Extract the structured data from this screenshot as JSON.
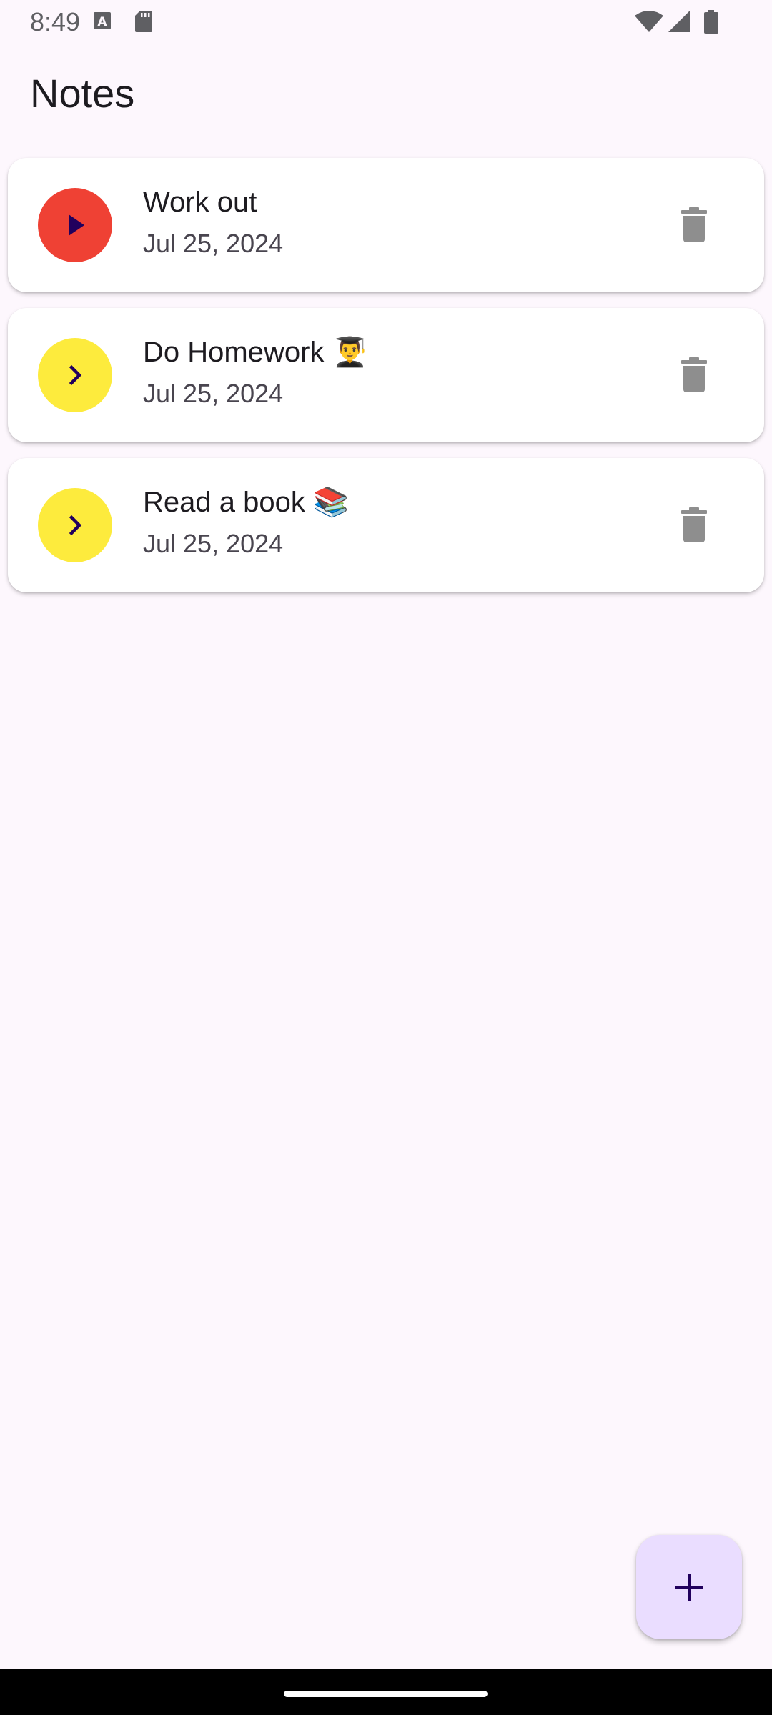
{
  "status_bar": {
    "time": "8:49",
    "icons": [
      "a-notification-icon",
      "sd-card-icon",
      "wifi-icon",
      "signal-icon",
      "battery-icon"
    ]
  },
  "app": {
    "title": "Notes"
  },
  "notes": [
    {
      "title": "Work out",
      "date": "Jul 25, 2024",
      "state": "active",
      "toggle_icon": "play-icon",
      "toggle_color": "#EF4134"
    },
    {
      "title": "Do Homework 👨‍🎓",
      "date": "Jul 25, 2024",
      "state": "pending",
      "toggle_icon": "chevron-right-icon",
      "toggle_color": "#FDEB3D"
    },
    {
      "title": "Read a book 📚",
      "date": "Jul 25, 2024",
      "state": "pending",
      "toggle_icon": "chevron-right-icon",
      "toggle_color": "#FDEB3D"
    }
  ],
  "fab": {
    "icon": "plus-icon",
    "color": "#EADDFF"
  },
  "colors": {
    "background": "#FDF7FD",
    "card": "#FFFFFF",
    "delete_icon": "#8E8E8E",
    "icon_dark": "#21005D"
  }
}
